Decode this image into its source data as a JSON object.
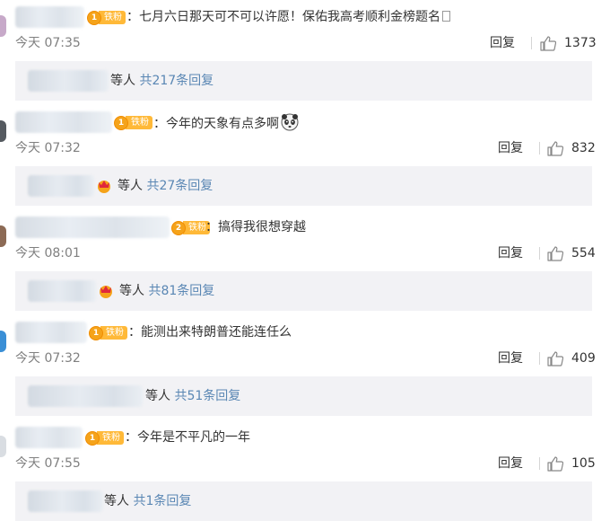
{
  "comments": [
    {
      "badge": "铁粉",
      "badge_level": "1",
      "text": "七月六日那天可不可以许愿！保佑我高考顺利金榜题名",
      "time": "今天 07:35",
      "reply_label": "回复",
      "likes": "1373",
      "reply_summary": {
        "who": "等人",
        "link": "共217条回复"
      }
    },
    {
      "badge": "铁粉",
      "badge_level": "1",
      "text": "今年的天象有点多啊",
      "time": "今天 07:32",
      "reply_label": "回复",
      "likes": "832",
      "reply_summary": {
        "who": "等人",
        "link": "共27条回复"
      }
    },
    {
      "badge": "铁粉",
      "badge_level": "2",
      "text": "搞得我很想穿越",
      "time": "今天 08:01",
      "reply_label": "回复",
      "likes": "554",
      "reply_summary": {
        "who": "等人",
        "link": "共81条回复"
      }
    },
    {
      "badge": "铁粉",
      "badge_level": "1",
      "text": "能测出来特朗普还能连任么",
      "time": "今天 07:32",
      "reply_label": "回复",
      "likes": "409",
      "reply_summary": {
        "who": "等人",
        "link": "共51条回复"
      }
    },
    {
      "badge": "铁粉",
      "badge_level": "1",
      "text": "今年是不平凡的一年",
      "time": "今天 07:55",
      "reply_label": "回复",
      "likes": "105",
      "reply_summary": {
        "who": "等人",
        "link": "共1条回复"
      }
    }
  ],
  "colors": {
    "link": "#5a87b4",
    "badge": "#ffb938",
    "reply_box": "#f2f2f5",
    "meta_text": "#808080"
  },
  "icons": {
    "like": "thumbs-up-icon",
    "badge": "crown-badge-icon",
    "emoji": "panda-emoji-icon"
  }
}
